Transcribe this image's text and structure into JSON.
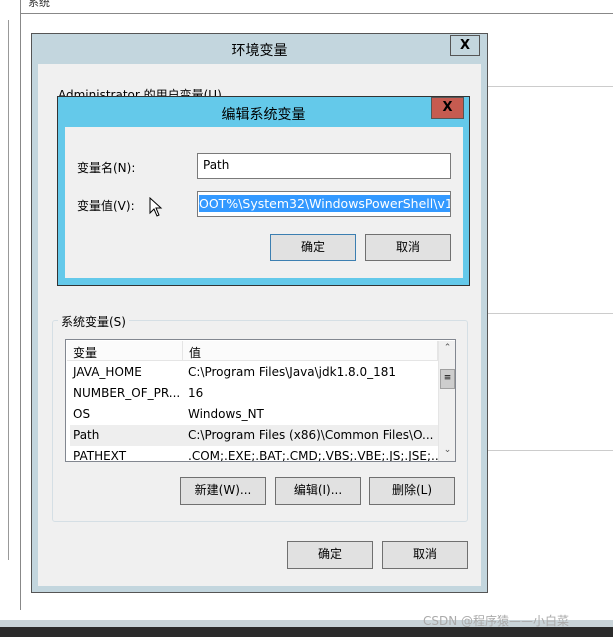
{
  "background": {
    "nav_item": "系统"
  },
  "env_dialog": {
    "title": "环境变量",
    "close_label": "X",
    "user_vars_label": "Administrator 的用户变量(U)",
    "system_vars_label": "系统变量(S)",
    "columns": [
      "变量",
      "值"
    ],
    "rows": [
      {
        "name": "JAVA_HOME",
        "value": "C:\\Program Files\\Java\\jdk1.8.0_181"
      },
      {
        "name": "NUMBER_OF_PR...",
        "value": "16"
      },
      {
        "name": "OS",
        "value": "Windows_NT"
      },
      {
        "name": "Path",
        "value": "C:\\Program Files (x86)\\Common Files\\O..."
      },
      {
        "name": "PATHEXT",
        "value": ".COM;.EXE;.BAT;.CMD;.VBS;.VBE;.JS;.JSE;..."
      }
    ],
    "new_button": "新建(W)...",
    "edit_button": "编辑(I)...",
    "delete_button": "删除(L)",
    "ok_button": "确定",
    "cancel_button": "取消"
  },
  "edit_dialog": {
    "title": "编辑系统变量",
    "close_label": "X",
    "name_label": "变量名(N):",
    "name_value": "Path",
    "value_label": "变量值(V):",
    "value_value": "OOT%\\System32\\WindowsPowerShell\\v1.0\\",
    "ok_button": "确定",
    "cancel_button": "取消"
  },
  "watermark": "CSDN @程序猿——小白菜",
  "colors": {
    "edit_titlebar": "#64c9ea",
    "close_red": "#c65b50",
    "selection": "#3399ff",
    "env_titlebar": "#c3d6de"
  }
}
